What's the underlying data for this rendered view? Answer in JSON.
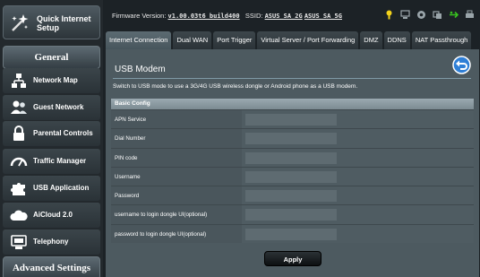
{
  "sidebar": {
    "quick_setup": "Quick Internet Setup",
    "general_title": "General",
    "items": [
      {
        "label": "Network Map"
      },
      {
        "label": "Guest Network"
      },
      {
        "label": "Parental Controls"
      },
      {
        "label": "Traffic Manager"
      },
      {
        "label": "USB Application"
      },
      {
        "label": "AiCloud 2.0"
      },
      {
        "label": "Telephony"
      }
    ],
    "advanced_title": "Advanced Settings"
  },
  "topbar": {
    "firmware_label": "Firmware Version:",
    "firmware_value": "v1.00.03t6 build400",
    "ssid_label": "SSID:",
    "ssid_2g": "ASUS_SA_2G",
    "ssid_5g": "ASUS_SA_5G"
  },
  "tabs": [
    {
      "label": "Internet Connection",
      "active": true
    },
    {
      "label": "Dual WAN"
    },
    {
      "label": "Port Trigger"
    },
    {
      "label": "Virtual Server / Port Forwarding"
    },
    {
      "label": "DMZ"
    },
    {
      "label": "DDNS"
    },
    {
      "label": "NAT Passthrough"
    }
  ],
  "main": {
    "title": "USB Modem",
    "description": "Switch to USB mode to use a 3G/4G USB wireless dongle or Android phone as a USB modem.",
    "section_header": "Basic Config",
    "fields": [
      {
        "label": "APN Service",
        "value": ""
      },
      {
        "label": "Dial Number",
        "value": ""
      },
      {
        "label": "PIN code",
        "value": ""
      },
      {
        "label": "Username",
        "value": ""
      },
      {
        "label": "Password",
        "value": ""
      },
      {
        "label": "username to login dongle UI(optional)",
        "value": ""
      },
      {
        "label": "password to login dongle UI(optional)",
        "value": ""
      }
    ],
    "apply_label": "Apply"
  },
  "colors": {
    "accent_blue": "#2f7fd6",
    "status_yellow": "#f2d21b",
    "status_green": "#38c21f"
  }
}
